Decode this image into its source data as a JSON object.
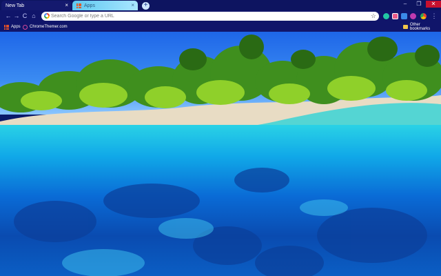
{
  "tabs": [
    {
      "title": "New Tab",
      "active": true
    },
    {
      "title": "Apps",
      "active": false
    }
  ],
  "window_controls": {
    "minimize": "–",
    "maximize": "❐",
    "close": "✕"
  },
  "toolbar": {
    "back": "←",
    "forward": "→",
    "reload": "C",
    "home": "⌂",
    "omnibox_placeholder": "Search Google or type a URL",
    "bookmark_star": "☆"
  },
  "bookmarks": {
    "apps_label": "Apps",
    "chromethemer_label": "ChromeThemer.com",
    "other_label": "Other bookmarks"
  },
  "colors": {
    "tabstrip": "#0d1460",
    "toolbar": "#10156a",
    "close_button": "#c8102e"
  },
  "background": "tropical island shoreline half-underwater"
}
